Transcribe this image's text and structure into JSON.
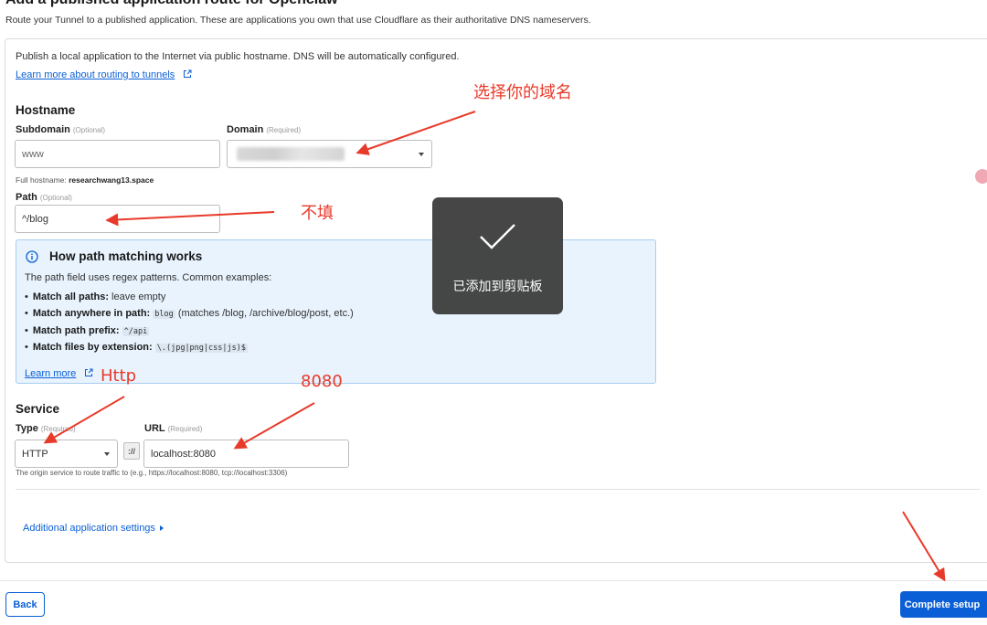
{
  "header": {
    "title": "Add a published application route for Openclaw",
    "subtitle": "Route your Tunnel to a published application. These are applications you own that use Cloudflare as their authoritative DNS nameservers."
  },
  "intro": {
    "text": "Publish a local application to the Internet via public hostname. DNS will be automatically configured.",
    "learn_more": "Learn more about routing to tunnels"
  },
  "hostname": {
    "section_title": "Hostname",
    "subdomain_label": "Subdomain",
    "subdomain_hint": "(Optional)",
    "subdomain_value": "www",
    "domain_label": "Domain",
    "domain_hint": "(Required)",
    "full_hostname_label": "Full hostname:",
    "full_hostname_value": "researchwang13.space",
    "path_label": "Path",
    "path_hint": "(Optional)",
    "path_value": "^/blog"
  },
  "path_help": {
    "title": "How path matching works",
    "description": "The path field uses regex patterns. Common examples:",
    "items": [
      {
        "label": "Match all paths:",
        "text": "leave empty",
        "code": "",
        "suffix": ""
      },
      {
        "label": "Match anywhere in path:",
        "text": "",
        "code": "blog",
        "suffix": "(matches /blog, /archive/blog/post, etc.)"
      },
      {
        "label": "Match path prefix:",
        "text": "",
        "code": "^/api",
        "suffix": ""
      },
      {
        "label": "Match files by extension:",
        "text": "",
        "code": "\\.(jpg|png|css|js)$",
        "suffix": ""
      }
    ],
    "learn_more": "Learn more"
  },
  "service": {
    "section_title": "Service",
    "type_label": "Type",
    "type_hint": "(Required)",
    "type_value": "HTTP",
    "protocol_sep": "://",
    "url_label": "URL",
    "url_hint": "(Required)",
    "url_value": "localhost:8080",
    "note": "The origin service to route traffic to (e.g., https://localhost:8080, tcp://localhost:3306)"
  },
  "additional_settings": "Additional application settings",
  "footer": {
    "back": "Back",
    "complete": "Complete setup"
  },
  "toast": {
    "text": "已添加到剪贴板"
  },
  "annotations": {
    "domain": "选择你的域名",
    "path": "不填",
    "type": "Http",
    "url": "8080"
  },
  "colors": {
    "primary": "#0b5fd6",
    "annotation": "#e83a2a",
    "info_bg": "#e8f3fd"
  }
}
